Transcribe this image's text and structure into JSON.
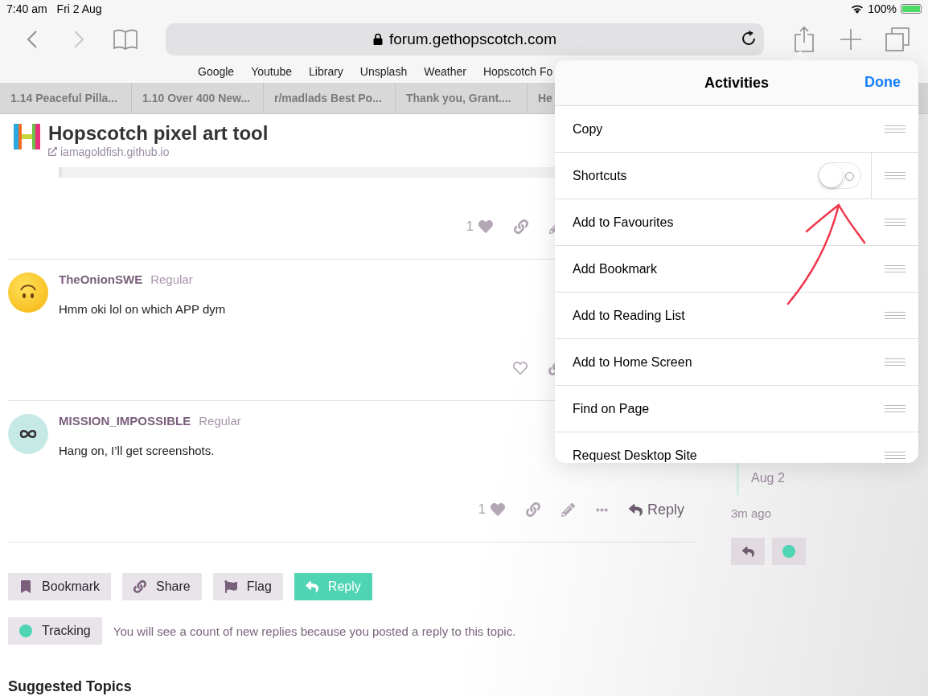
{
  "status_bar": {
    "time": "7:40 am",
    "date": "Fri 2 Aug",
    "battery": "100%"
  },
  "toolbar": {
    "url": "forum.gethopscotch.com"
  },
  "bookmarks": [
    "Google",
    "Youtube",
    "Library",
    "Unsplash",
    "Weather",
    "Hopscotch Fo"
  ],
  "tabs": [
    "1.14 Peaceful Pilla...",
    "1.10 Over 400 New...",
    "r/madlads Best Po...",
    "Thank you, Grant....",
    "He"
  ],
  "topic": {
    "title": "Hopscotch pixel art tool",
    "link": "iamagoldfish.github.io"
  },
  "posts": [
    {
      "kind": "onebox",
      "likes": "1",
      "actions": [
        {
          "kind": "like"
        },
        {
          "kind": "link"
        },
        {
          "kind": "edit"
        }
      ]
    },
    {
      "kind": "post",
      "avatar": {
        "kind": "emoji"
      },
      "user": "TheOnionSWE",
      "badge": "Regular",
      "text": "Hmm oki lol on which APP dym",
      "actions": [
        {
          "kind": "like-empty"
        },
        {
          "kind": "link"
        }
      ]
    },
    {
      "kind": "post",
      "avatar": {
        "kind": "infinity"
      },
      "user": "MISSION_IMPOSSIBLE",
      "badge": "Regular",
      "text": "Hang on, I’ll get screenshots.",
      "likes": "1",
      "actions": [
        {
          "kind": "like"
        },
        {
          "kind": "link"
        },
        {
          "kind": "edit"
        },
        {
          "kind": "more"
        }
      ],
      "reply": "Reply"
    }
  ],
  "footer_buttons": [
    {
      "kind": "bookmark",
      "label": "Bookmark",
      "primary": false
    },
    {
      "kind": "share",
      "label": "Share",
      "primary": false
    },
    {
      "kind": "flag",
      "label": "Flag",
      "primary": false
    },
    {
      "kind": "reply",
      "label": "Reply",
      "primary": true
    }
  ],
  "tracking": {
    "label": "Tracking",
    "text": "You will see a count of new replies because you posted a reply to this topic."
  },
  "suggested": "Suggested Topics",
  "timeline": {
    "date": "Aug 2",
    "ago": "3m ago"
  },
  "activities": {
    "title": "Activities",
    "done": "Done",
    "items": [
      {
        "label": "Copy",
        "kind": "plain"
      },
      {
        "label": "Shortcuts",
        "kind": "toggle",
        "on": false
      },
      {
        "label": "Add to Favourites",
        "kind": "plain"
      },
      {
        "label": "Add Bookmark",
        "kind": "plain"
      },
      {
        "label": "Add to Reading List",
        "kind": "plain"
      },
      {
        "label": "Add to Home Screen",
        "kind": "plain"
      },
      {
        "label": "Find on Page",
        "kind": "plain"
      },
      {
        "label": "Request Desktop Site",
        "kind": "plain"
      }
    ]
  }
}
